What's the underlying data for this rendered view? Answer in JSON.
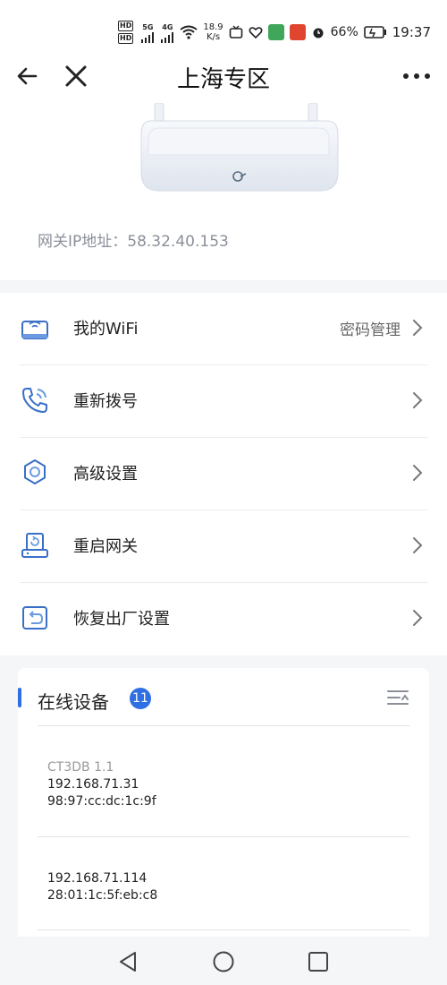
{
  "status_bar": {
    "hd_top": "HD",
    "hd_bottom": "HD",
    "signal1": "5G",
    "signal2": "4G",
    "net_speed": "18.9",
    "net_unit": "K/s",
    "battery": "66%",
    "time": "19:37"
  },
  "header": {
    "title": "上海专区"
  },
  "router": {
    "gateway_ip": "网关IP地址：58.32.40.153"
  },
  "menu": {
    "items": [
      {
        "label": "我的WiFi",
        "right_text": "密码管理",
        "icon": "wifi-router-icon"
      },
      {
        "label": "重新拨号",
        "right_text": "",
        "icon": "phone-icon"
      },
      {
        "label": "高级设置",
        "right_text": "",
        "icon": "gear-icon"
      },
      {
        "label": "重启网关",
        "right_text": "",
        "icon": "restart-gateway-icon"
      },
      {
        "label": "恢复出厂设置",
        "right_text": "",
        "icon": "factory-reset-icon"
      }
    ]
  },
  "online_devices": {
    "title": "在线设备",
    "count": "11",
    "devices": [
      {
        "name": "CT3DB 1.1",
        "ip": "192.168.71.31",
        "mac": "98:97:cc:dc:1c:9f"
      },
      {
        "name": "",
        "ip": "192.168.71.114",
        "mac": "28:01:1c:5f:eb:c8"
      }
    ]
  },
  "colors": {
    "accent": "#2f6fe4",
    "muted_text": "#8a8f99",
    "background": "#f5f6f8"
  }
}
